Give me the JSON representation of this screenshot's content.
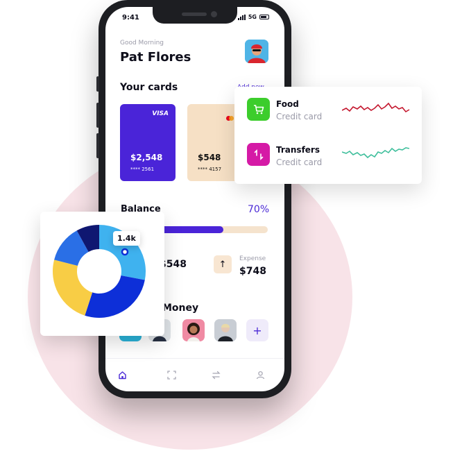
{
  "status_bar": {
    "time": "9:41",
    "network": "5G"
  },
  "header": {
    "greeting": "Good Morning",
    "user_name": "Pat Flores"
  },
  "cards_section": {
    "title": "Your cards",
    "add_label": "Add new",
    "cards": [
      {
        "brand": "VISA",
        "amount": "$2,548",
        "number": "**** 2561",
        "color": "#4a24d8"
      },
      {
        "brand": "mastercard",
        "amount": "$548",
        "number": "**** 4157",
        "color": "#f6e0c5"
      }
    ]
  },
  "balance": {
    "label": "Balance",
    "percent_label": "70%",
    "progress": 0.7
  },
  "income": {
    "amount": "$548"
  },
  "expense": {
    "label": "Expense",
    "amount": "$748",
    "icon": "arrow-up-icon"
  },
  "send_money": {
    "title": "Money",
    "add_icon": "plus-icon"
  },
  "tabbar": {
    "items": [
      "home-icon",
      "scan-icon",
      "transfer-icon",
      "profile-icon"
    ]
  },
  "pie": {
    "tooltip": "1.4k",
    "slices": [
      {
        "value": 28,
        "color": "#3fb2ef"
      },
      {
        "value": 27,
        "color": "#0d2fd8"
      },
      {
        "value": 24,
        "color": "#f8cd45"
      },
      {
        "value": 13,
        "color": "#2a6fe6"
      },
      {
        "value": 8,
        "color": "#0f1771"
      }
    ]
  },
  "transactions": [
    {
      "name": "Food",
      "sub": "Credit card",
      "icon": "shopping-cart-icon",
      "icon_color": "#3ccd2c",
      "line_color": "#c4172e"
    },
    {
      "name": "Transfers",
      "sub": "Credit card",
      "icon": "transfer-icon",
      "icon_color": "#d51aa6",
      "line_color": "#3fbf9c"
    }
  ]
}
